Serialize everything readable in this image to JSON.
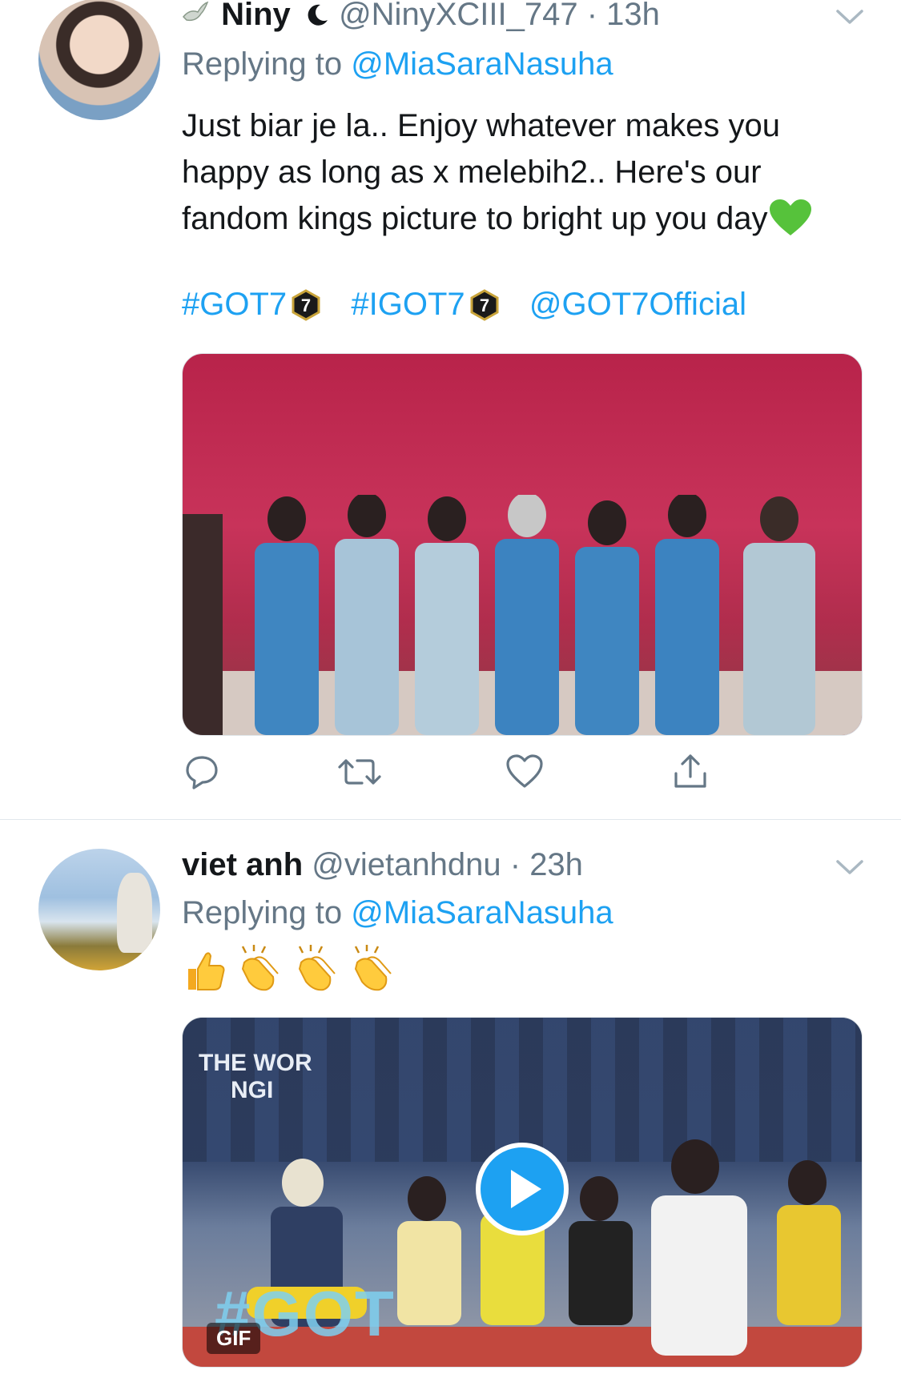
{
  "tweets": [
    {
      "name": "Niny",
      "name_suffix_icon": "crescent-moon-icon",
      "handle": "@NinyXCIII_747",
      "dot": "·",
      "time": "13h",
      "replying_prefix": "Replying to",
      "replying_to": "@MiaSaraNasuha",
      "text": "Just biar je la.. Enjoy whatever makes you happy as long as x melebih2.. Here's our fandom kings picture to bright up you day",
      "text_emoji": "green-heart-icon",
      "hashtag1": "#GOT7",
      "hashtag2": "#IGOT7",
      "mention": "@GOT7Official",
      "media_type": "photo"
    },
    {
      "name": "viet anh",
      "handle": "@vietanhdnu",
      "dot": "·",
      "time": "23h",
      "replying_prefix": "Replying to",
      "replying_to": "@MiaSaraNasuha",
      "emojis": [
        "thumbs-up-icon",
        "clapping-hands-icon",
        "clapping-hands-icon",
        "clapping-hands-icon"
      ],
      "media_type": "gif",
      "gif_label": "GIF",
      "gif_overlay_text": "THE WOR",
      "gif_overlay_text2": "NGI",
      "gif_hashtag": "#GOT"
    }
  ],
  "actions": [
    "reply-icon",
    "retweet-icon",
    "like-icon",
    "share-icon"
  ],
  "colors": {
    "link": "#1da1f2",
    "secondary": "#657786",
    "text": "#14171a"
  }
}
